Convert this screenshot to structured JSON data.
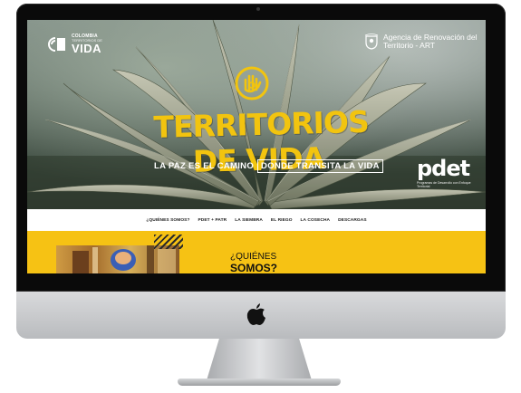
{
  "header": {
    "brand_top": "COLOMBIA",
    "brand_mid": "TERRITORIOS DE",
    "brand_main": "VIDA",
    "agency": "Agencia de Renovación del Territorio - ART"
  },
  "hero": {
    "title": "TERRITORIOS DE VIDA",
    "tagline_part1": "LA PAZ ES EL CAMINO",
    "tagline_part2": "DONDE TRANSITA LA VIDA"
  },
  "pdet": {
    "logo": "pdet",
    "subtitle": "Programas de Desarrollo con Enfoque Territorial"
  },
  "nav": {
    "items": [
      "¿QUIÉNES SOMOS?",
      "PDET + PATR",
      "LA SIEMBRA",
      "EL RIEGO",
      "LA COSECHA",
      "DESCARGAS"
    ]
  },
  "about": {
    "question": "¿QUIÉNES",
    "strong": "SOMOS?"
  },
  "colors": {
    "brand_yellow": "#f6c214",
    "title_yellow": "#f2c40f",
    "nav_bg": "#ffffff"
  },
  "icons": [
    "colombia-vida-logo-icon",
    "colombia-shield-icon",
    "hand-badge-icon",
    "apple-icon"
  ]
}
